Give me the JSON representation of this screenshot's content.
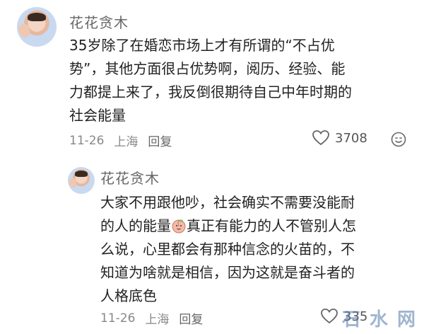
{
  "comment1": {
    "username": "花花贪木",
    "lines": [
      "35岁除了在婚恋市场上才有所谓的“不占优",
      "势”，其他方面很占优势啊，阅历、经验、能",
      "力都提上来了，我反倒很期待自己中年时期的",
      "社会能量"
    ],
    "date": "11-26",
    "location": "上海",
    "reply_label": "回复",
    "likes": "3708"
  },
  "comment2": {
    "username": "花花贪木",
    "line1": "大家不用跟他吵，社会确实不需要没能耐",
    "line2_before": "的人的能量",
    "line2_after": "真正有能力的人不管别人怎",
    "line3": "么说，心里都会有那种信念的火苗的，不",
    "line4": "知道为啥就是相信，因为这就是奋斗者的",
    "line5": "人格底色",
    "date": "11-26",
    "location": "上海",
    "reply_label": "回复",
    "likes": "335"
  },
  "watermark": "石 水 网"
}
